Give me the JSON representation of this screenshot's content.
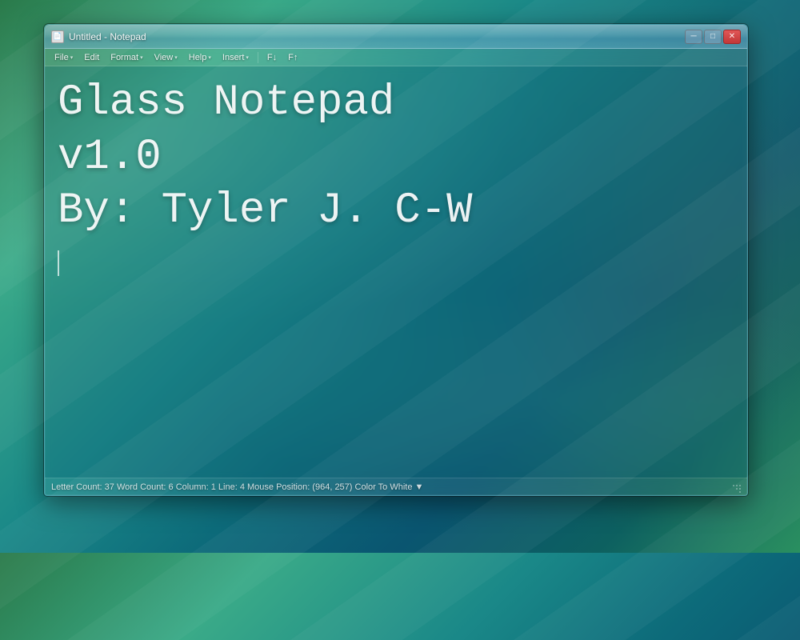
{
  "desktop": {
    "background_description": "Windows Vista Aero teal green desktop"
  },
  "window": {
    "title": "Untitled - Notepad",
    "titlebar_icon": "📄"
  },
  "titlebar_controls": {
    "minimize_label": "─",
    "maximize_label": "□",
    "close_label": "✕"
  },
  "menubar": {
    "items": [
      {
        "label": "File",
        "has_arrow": true
      },
      {
        "label": "Edit",
        "has_arrow": false
      },
      {
        "label": "Format",
        "has_arrow": true
      },
      {
        "label": "View",
        "has_arrow": true
      },
      {
        "label": "Help",
        "has_arrow": true
      },
      {
        "label": "Insert",
        "has_arrow": true
      },
      {
        "label": "F↓",
        "has_arrow": false
      },
      {
        "label": "F↑",
        "has_arrow": false
      }
    ]
  },
  "content": {
    "text": "Glass Notepad\nv1.0\nBy: Tyler J. C-W"
  },
  "statusbar": {
    "letter_count_label": "Letter Count:",
    "letter_count_value": "37",
    "word_count_label": "Word Count:",
    "word_count_value": "6",
    "column_label": "Column:",
    "column_value": "1",
    "line_label": "Line:",
    "line_value": "4",
    "mouse_pos_label": "Mouse Position:",
    "mouse_pos_value": "(964, 257)",
    "color_label": "Color To White",
    "full_status": "Letter Count: 37  Word Count: 6  Column: 1  Line: 4  Mouse Position: (964, 257)  Color To White ▼"
  }
}
